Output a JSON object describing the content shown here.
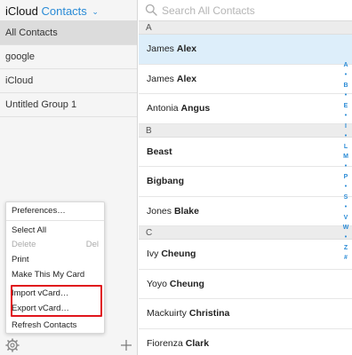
{
  "header": {
    "brand": "iCloud",
    "app": "Contacts",
    "caret": "⌄"
  },
  "groups": [
    {
      "label": "All Contacts",
      "selected": true
    },
    {
      "label": "google"
    },
    {
      "label": "iCloud"
    },
    {
      "label": "Untitled Group 1"
    }
  ],
  "menu": {
    "items": [
      {
        "label": "Preferences…"
      },
      {
        "label": "Select All"
      },
      {
        "label": "Delete",
        "shortcut": "Del",
        "disabled": true
      },
      {
        "label": "Print"
      },
      {
        "label": "Make This My Card"
      },
      {
        "label": "Import vCard…"
      },
      {
        "label": "Export vCard…"
      },
      {
        "label": "Refresh Contacts"
      }
    ]
  },
  "search": {
    "placeholder": "Search All Contacts"
  },
  "sections": [
    {
      "letter": "A",
      "contacts": [
        {
          "first": "James",
          "last": "Alex",
          "selected": true
        },
        {
          "first": "James",
          "last": "Alex"
        },
        {
          "first": "Antonia",
          "last": "Angus"
        }
      ]
    },
    {
      "letter": "B",
      "contacts": [
        {
          "first": "",
          "last": "Beast"
        },
        {
          "first": "",
          "last": "Bigbang"
        },
        {
          "first": "Jones",
          "last": "Blake"
        }
      ]
    },
    {
      "letter": "C",
      "contacts": [
        {
          "first": "Ivy",
          "last": "Cheung"
        },
        {
          "first": "Yoyo",
          "last": "Cheung"
        },
        {
          "first": "Mackuirty",
          "last": "Christina"
        },
        {
          "first": "Fiorenza",
          "last": "Clark"
        }
      ]
    }
  ],
  "alpha_index": [
    "A",
    "•",
    "B",
    "•",
    "E",
    "•",
    "I",
    "•",
    "L",
    "M",
    "•",
    "P",
    "•",
    "S",
    "•",
    "V",
    "W",
    "•",
    "Z",
    "#"
  ],
  "colors": {
    "accent": "#2a8bd6",
    "highlight": "#e0141b",
    "selected_row": "#ddeefa"
  }
}
